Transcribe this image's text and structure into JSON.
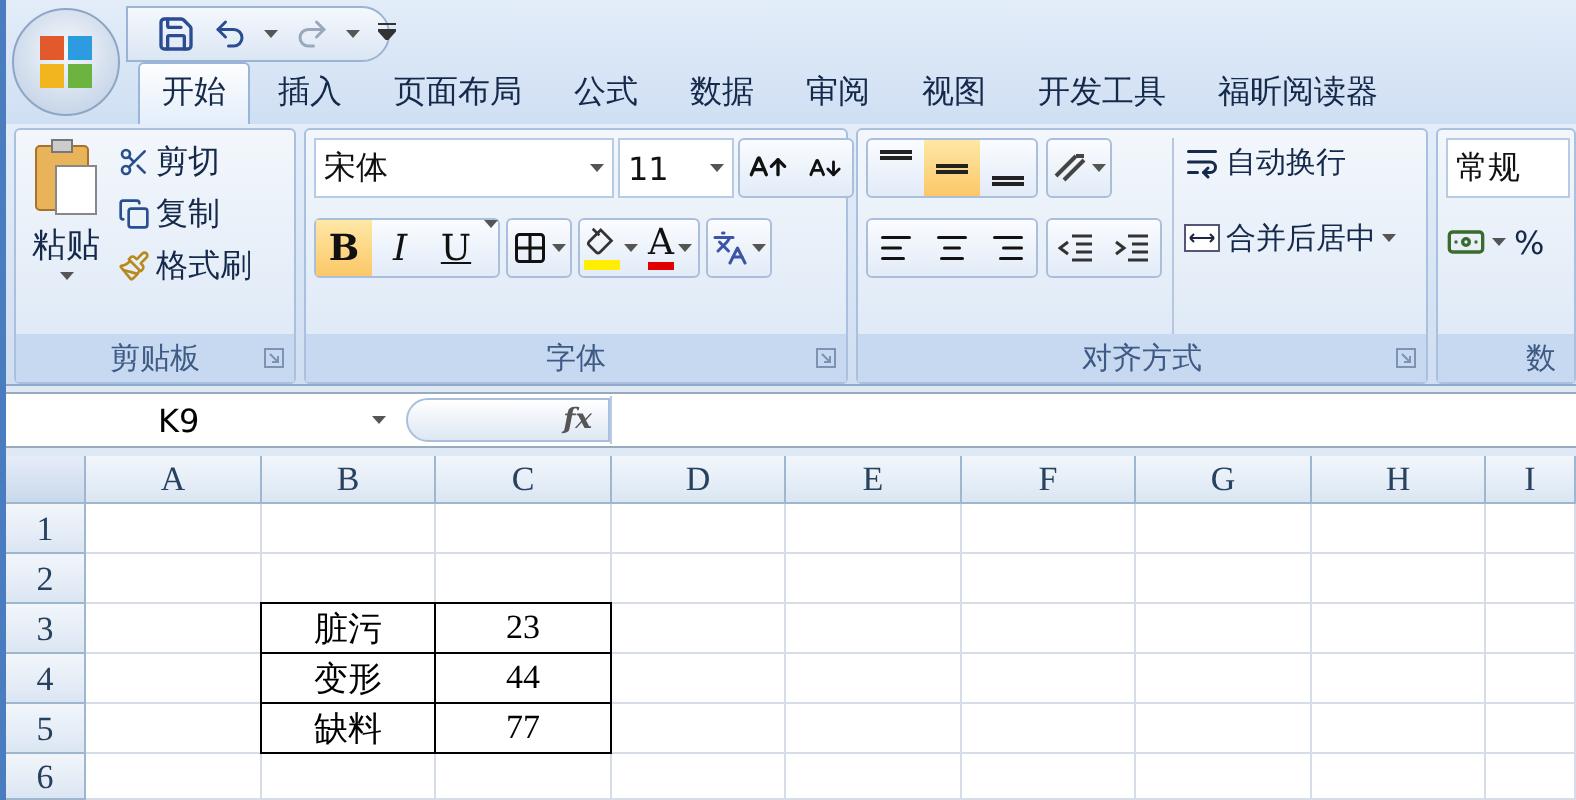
{
  "tabs": [
    {
      "label": "开始",
      "selected": true
    },
    {
      "label": "插入",
      "selected": false
    },
    {
      "label": "页面布局",
      "selected": false
    },
    {
      "label": "公式",
      "selected": false
    },
    {
      "label": "数据",
      "selected": false
    },
    {
      "label": "审阅",
      "selected": false
    },
    {
      "label": "视图",
      "selected": false
    },
    {
      "label": "开发工具",
      "selected": false
    },
    {
      "label": "福昕阅读器",
      "selected": false
    }
  ],
  "clipboard": {
    "paste": "粘贴",
    "cut": "剪切",
    "copy": "复制",
    "format_painter": "格式刷",
    "title": "剪贴板"
  },
  "font": {
    "name": "宋体",
    "size": "11",
    "title": "字体",
    "font_color_label": "A",
    "styles": [
      {
        "label": "B",
        "selected": true
      },
      {
        "label": "I",
        "selected": false
      },
      {
        "label": "U",
        "selected": false
      }
    ]
  },
  "alignment": {
    "wrap": "自动换行",
    "merge": "合并后居中",
    "title": "对齐方式",
    "vertical": [
      {
        "kind": "top",
        "selected": false
      },
      {
        "kind": "middle",
        "selected": true
      },
      {
        "kind": "bottom",
        "selected": false
      }
    ]
  },
  "number": {
    "format": "常规",
    "percent": "%",
    "title": "数"
  },
  "formula_bar": {
    "name_box": "K9",
    "fx": "fx"
  },
  "sheet": {
    "columns": [
      "A",
      "B",
      "C",
      "D",
      "E",
      "F",
      "G",
      "H",
      "I"
    ],
    "rows": [
      "1",
      "2",
      "3",
      "4",
      "5",
      "6"
    ]
  },
  "table": [
    {
      "label": "脏污",
      "value": "23"
    },
    {
      "label": "变形",
      "value": "44"
    },
    {
      "label": "缺料",
      "value": "77"
    }
  ]
}
